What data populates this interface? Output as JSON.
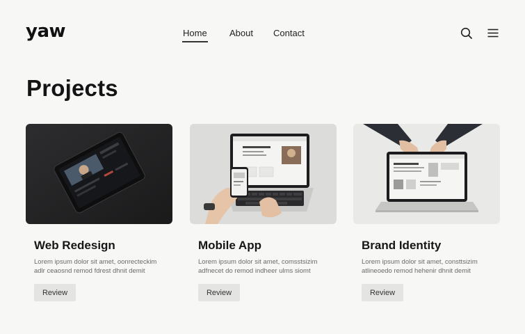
{
  "brand": {
    "logo": "yaw"
  },
  "nav": {
    "items": [
      "Home",
      "About",
      "Contact"
    ],
    "active": "Home"
  },
  "header_icons": [
    "search-icon",
    "menu-icon"
  ],
  "page": {
    "title": "Projects"
  },
  "projects": [
    {
      "title": "Web Redesign",
      "desc_line1": "Lorem ipsum dolor sit amet, oonrecteckim",
      "desc_line2": "adlr ceaosnd remod fdrest dhnit demit",
      "button": "Review",
      "image": "tablet-on-dark-surface"
    },
    {
      "title": "Mobile App",
      "desc_line1": "Lorem ipsum dolor sit amet, comsstsizim",
      "desc_line2": "adfnecet do remod indheer ulms siomt",
      "button": "Review",
      "image": "laptop-and-phone-in-hands"
    },
    {
      "title": "Brand Identity",
      "desc_line1": "Lorem ipsum dolor sit amet, consttsizim",
      "desc_line2": "atlineoedo remod hehenir dhnit demit",
      "button": "Review",
      "image": "hands-holding-laptop"
    }
  ],
  "colors": {
    "background": "#f7f7f6",
    "text": "#161616",
    "button": "#e4e4e2",
    "muted": "#6a6a6a"
  }
}
